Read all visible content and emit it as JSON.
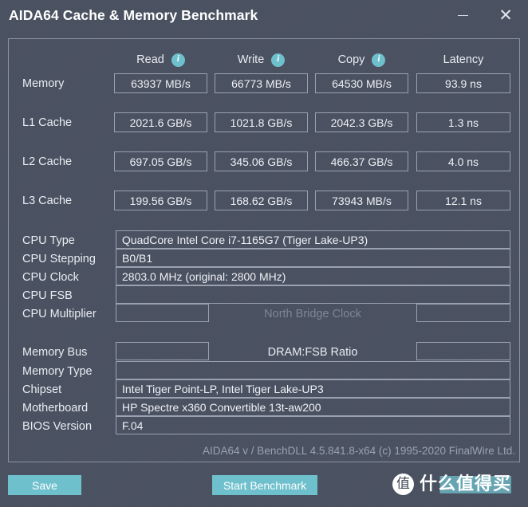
{
  "window": {
    "title": "AIDA64 Cache & Memory Benchmark",
    "minimize_label": "–",
    "close_label": "✕"
  },
  "benchmark": {
    "columns": [
      {
        "label": "Read",
        "icon": "info-icon",
        "info": "i"
      },
      {
        "label": "Write",
        "icon": "info-icon",
        "info": "i"
      },
      {
        "label": "Copy",
        "icon": "info-icon",
        "info": "i"
      },
      {
        "label": "Latency",
        "icon": "",
        "info": ""
      }
    ],
    "rows": [
      {
        "label": "Memory",
        "read": "63937 MB/s",
        "write": "66773 MB/s",
        "copy": "64530 MB/s",
        "latency": "93.9 ns"
      },
      {
        "label": "L1 Cache",
        "read": "2021.6 GB/s",
        "write": "1021.8 GB/s",
        "copy": "2042.3 GB/s",
        "latency": "1.3 ns"
      },
      {
        "label": "L2 Cache",
        "read": "697.05 GB/s",
        "write": "345.06 GB/s",
        "copy": "466.37 GB/s",
        "latency": "4.0 ns"
      },
      {
        "label": "L3 Cache",
        "read": "199.56 GB/s",
        "write": "168.62 GB/s",
        "copy": "73943 MB/s",
        "latency": "12.1 ns"
      }
    ]
  },
  "cpu_info": {
    "cpu_type_label": "CPU Type",
    "cpu_type_value": "QuadCore Intel Core i7-1165G7  (Tiger Lake-UP3)",
    "cpu_stepping_label": "CPU Stepping",
    "cpu_stepping_value": "B0/B1",
    "cpu_clock_label": "CPU Clock",
    "cpu_clock_value": "2803.0 MHz  (original: 2800 MHz)",
    "cpu_fsb_label": "CPU FSB",
    "cpu_fsb_value": "",
    "cpu_multiplier_label": "CPU Multiplier",
    "cpu_multiplier_value": "",
    "north_bridge_clock_label": "North Bridge Clock",
    "north_bridge_clock_value": ""
  },
  "memory_info": {
    "memory_bus_label": "Memory Bus",
    "memory_bus_value": "",
    "dram_fsb_ratio_label": "DRAM:FSB Ratio",
    "dram_fsb_ratio_value": "",
    "memory_type_label": "Memory Type",
    "memory_type_value": "",
    "chipset_label": "Chipset",
    "chipset_value": "Intel Tiger Point-LP, Intel Tiger Lake-UP3",
    "motherboard_label": "Motherboard",
    "motherboard_value": "HP Spectre x360 Convertible 13t-aw200",
    "bios_version_label": "BIOS Version",
    "bios_version_value": "F.04"
  },
  "footer": {
    "version_text": "AIDA64 v / BenchDLL 4.5.841.8-x64  (c) 1995-2020 FinalWire Ltd.",
    "save_label": "Save",
    "start_benchmark_label": "Start Benchmark"
  },
  "watermark": {
    "badge": "值",
    "text": "什么值得买"
  },
  "colors": {
    "background": "#4a5160",
    "accent": "#6fc0cd",
    "border": "#9aa2b0",
    "text": "#e9edf3",
    "dim_text": "#7e8795"
  }
}
